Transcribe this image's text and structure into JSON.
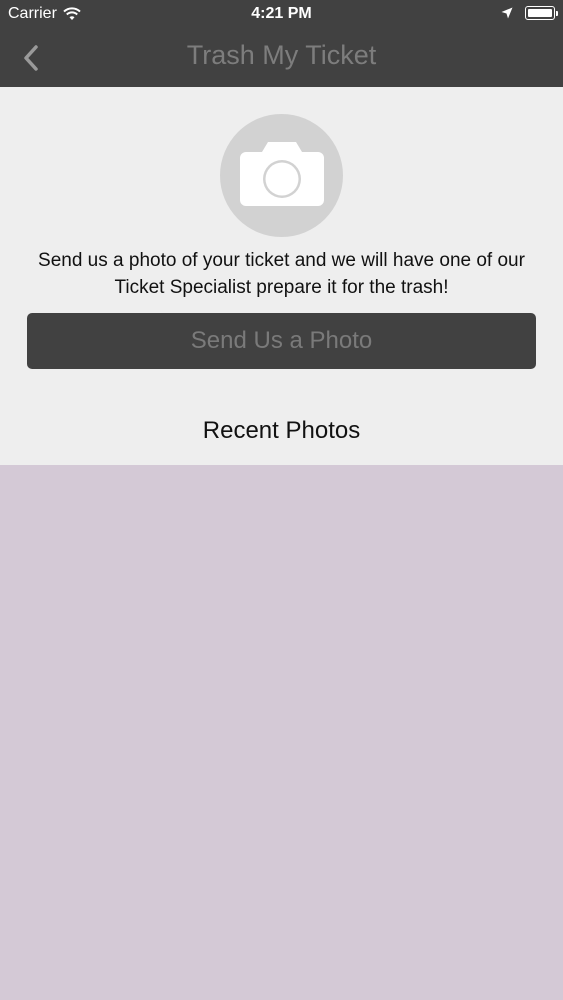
{
  "status_bar": {
    "carrier": "Carrier",
    "time": "4:21 PM",
    "wifi_icon": "wifi-icon",
    "location_icon": "location-arrow-icon",
    "battery_icon": "battery-icon",
    "battery_level": 1.0
  },
  "nav": {
    "title": "Trash My Ticket",
    "back_icon": "chevron-left-icon"
  },
  "main": {
    "camera_icon": "camera-icon",
    "instructions": "Send us a photo of your ticket and we will have one of our Ticket Specialist prepare it for the trash!",
    "send_button_label": "Send Us a Photo",
    "recent_heading": "Recent Photos"
  },
  "colors": {
    "bar_background": "#414141",
    "content_background": "#eeeeee",
    "photo_area_background": "#d4c9d6",
    "button_text": "#7a7a7a",
    "title_text": "#7d7d7d"
  }
}
